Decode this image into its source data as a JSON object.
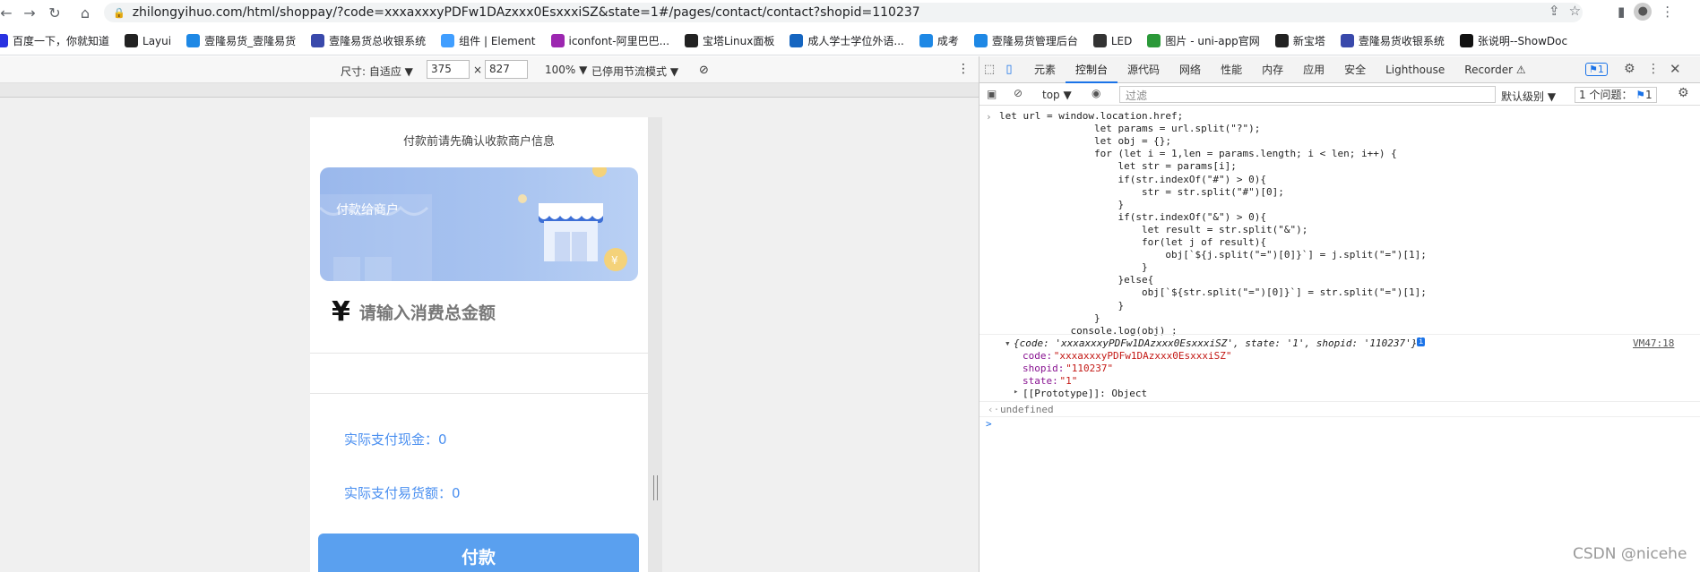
{
  "browser": {
    "url": "zhilongyihuo.com/html/shoppay/?code=xxxaxxxyPDFw1DAzxxx0EsxxxiSZ&state=1#/pages/contact/contact?shopid=110237"
  },
  "bookmarks": [
    {
      "label": "百度一下，你就知道",
      "icon": "paw-icon",
      "color": "#2932e1"
    },
    {
      "label": "Layui",
      "icon": "layui-icon",
      "color": "#222222"
    },
    {
      "label": "壹隆易货_壹隆易货",
      "icon": "site-icon",
      "color": "#1e88e5"
    },
    {
      "label": "壹隆易货总收银系统",
      "icon": "site-icon",
      "color": "#3949ab"
    },
    {
      "label": "组件 | Element",
      "icon": "element-icon",
      "color": "#409eff"
    },
    {
      "label": "iconfont-阿里巴巴...",
      "icon": "iconfont-icon",
      "color": "#9c27b0"
    },
    {
      "label": "宝塔Linux面板",
      "icon": "bt-icon",
      "color": "#222222"
    },
    {
      "label": "成人学士学位外语...",
      "icon": "site-icon",
      "color": "#1565c0"
    },
    {
      "label": "成考",
      "icon": "folder-icon",
      "color": "#1e88e5"
    },
    {
      "label": "壹隆易货管理后台",
      "icon": "site-icon",
      "color": "#1e88e5"
    },
    {
      "label": "LED",
      "icon": "globe-icon",
      "color": "#333333"
    },
    {
      "label": "图片 - uni-app官网",
      "icon": "u-icon",
      "color": "#2b9939"
    },
    {
      "label": "新宝塔",
      "icon": "bt-icon",
      "color": "#222222"
    },
    {
      "label": "壹隆易货收银系统",
      "icon": "site-icon",
      "color": "#3949ab"
    },
    {
      "label": "张说明--ShowDoc",
      "icon": "showdoc-icon",
      "color": "#111111"
    }
  ],
  "device_toolbar": {
    "size_label": "尺寸: 自适应 ▼",
    "width": "375",
    "times": "×",
    "height": "827",
    "zoom": "100% ▼",
    "throttle": "已停用节流模式 ▼"
  },
  "page": {
    "confirm_text": "付款前请先确认收款商户信息",
    "banner_label": "付款给商户",
    "yen": "¥",
    "amount_placeholder": "请输入消费总金额",
    "cash_label": "实际支付现金：",
    "cash_value": "0",
    "barter_label": "实际支付易货额：",
    "barter_value": "0",
    "pay_button": "付款"
  },
  "devtools": {
    "tabs": [
      "元素",
      "控制台",
      "源代码",
      "网络",
      "性能",
      "内存",
      "应用",
      "安全",
      "Lighthouse",
      "Recorder ⚠"
    ],
    "active_tab": "控制台",
    "issues_badge": "1",
    "context": "top ▼",
    "filter_placeholder": "过滤",
    "level": "默认级别 ▼",
    "issues_text": "1 个问题：",
    "issues_count": "1",
    "code_lines": [
      "let url = window.location.href;",
      "                let params = url.split(\"?\");",
      "                let obj = {};",
      "                for (let i = 1,len = params.length; i < len; i++) {",
      "                    let str = params[i];",
      "                    if(str.indexOf(\"#\") > 0){",
      "                        str = str.split(\"#\")[0];",
      "                    }",
      "                    if(str.indexOf(\"&\") > 0){",
      "                        let result = str.split(\"&\");",
      "                        for(let j of result){",
      "                            obj[`${j.split(\"=\")[0]}`] = j.split(\"=\")[1];",
      "                        }",
      "                    }else{",
      "                        obj[`${str.split(\"=\")[0]}`] = str.split(\"=\")[1];",
      "                    }",
      "                }",
      "            console.log(obj) ;"
    ],
    "object_summary": "{code: 'xxxaxxxyPDFw1DAzxxx0EsxxxiSZ', state: '1', shopid: '110237'}",
    "source_link": "VM47:18",
    "props": [
      {
        "key": "code",
        "value": "\"xxxaxxxyPDFw1DAzxxx0EsxxxiSZ\""
      },
      {
        "key": "shopid",
        "value": "\"110237\""
      },
      {
        "key": "state",
        "value": "\"1\""
      }
    ],
    "prototype": "[[Prototype]]: Object",
    "return_value": "undefined",
    "prompt": ">"
  },
  "watermark": "CSDN @nicehe"
}
